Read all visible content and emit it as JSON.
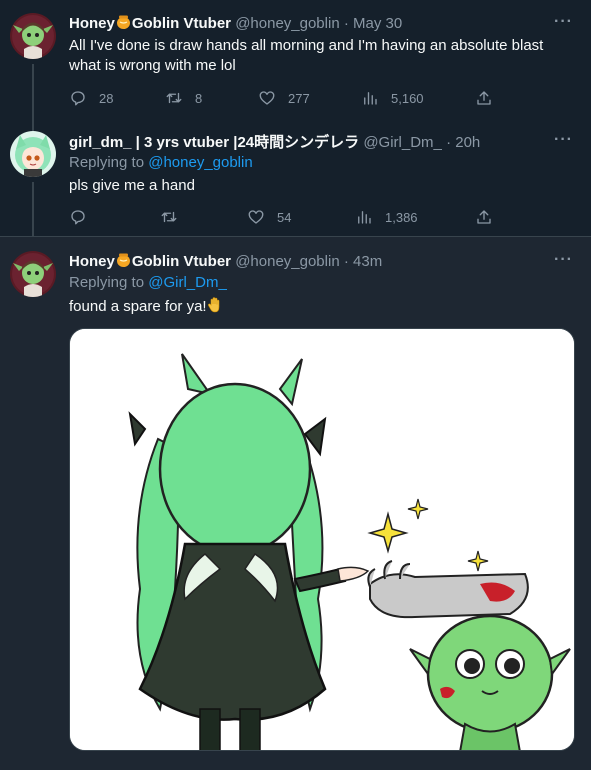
{
  "tweets": [
    {
      "name_part1": "Honey",
      "name_part2": "Goblin Vtuber",
      "handle": "@honey_goblin",
      "time": "· May 30",
      "text_line1": "All I've done is draw hands all morning and I'm having an absolute blast",
      "text_line2": "what is wrong with me lol",
      "replies": "28",
      "retweets": "8",
      "likes": "277",
      "views": "5,160"
    },
    {
      "name": "girl_dm_ | 3 yrs vtuber |24時間シンデレラ",
      "handle": "@Girl_Dm_",
      "time": "· 20h",
      "replying_prefix": "Replying to",
      "replying_handle": "@honey_goblin",
      "text": "pls give me a hand",
      "replies": "",
      "retweets": "",
      "likes": "54",
      "views": "1,386"
    },
    {
      "name_part1": "Honey",
      "name_part2": "Goblin Vtuber",
      "handle": "@honey_goblin",
      "time": "· 43m",
      "replying_prefix": "Replying to",
      "replying_handle": "@Girl_Dm_",
      "text": "found a spare for ya!",
      "text_emoji": "raised-hand-emoji"
    }
  ],
  "more_label": "···",
  "colors": {
    "background": "#15202b",
    "highlight_background": "#1e2732",
    "secondary_text": "#8b98a5",
    "link": "#1d9bf0",
    "primary_text": "#f7f9f9"
  }
}
